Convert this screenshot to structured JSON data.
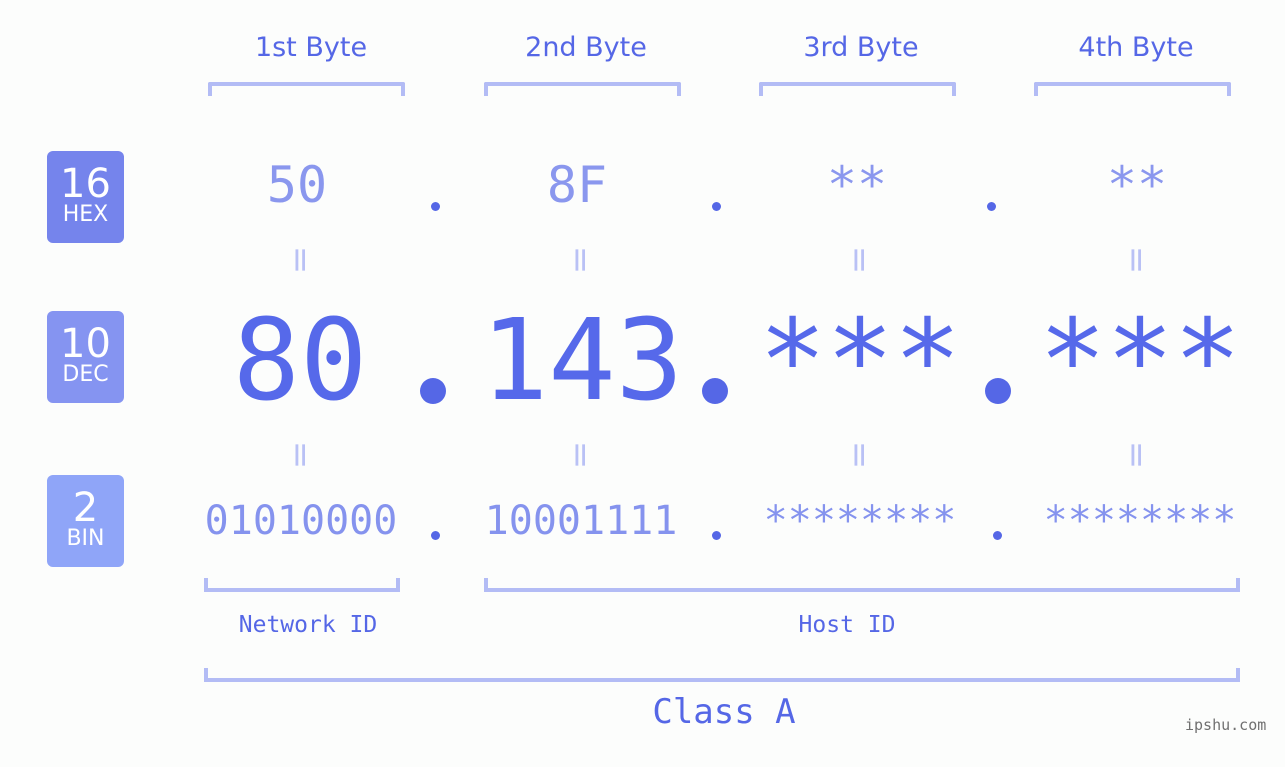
{
  "bytes": [
    {
      "label": "1st Byte",
      "hex": "50",
      "dec": "80",
      "bin": "01010000"
    },
    {
      "label": "2nd Byte",
      "hex": "8F",
      "dec": "143",
      "bin": "10001111"
    },
    {
      "label": "3rd Byte",
      "hex": "**",
      "dec": "***",
      "bin": "********"
    },
    {
      "label": "4th Byte",
      "hex": "**",
      "dec": "***",
      "bin": "********"
    }
  ],
  "badges": {
    "hex": {
      "num": "16",
      "label": "HEX",
      "color": "#7584ec"
    },
    "dec": {
      "num": "10",
      "label": "DEC",
      "color": "#8594f1"
    },
    "bin": {
      "num": "2",
      "label": "BIN",
      "color": "#8fa5f8"
    }
  },
  "equals_symbol": "=",
  "network_id_label": "Network ID",
  "host_id_label": "Host ID",
  "class_label": "Class A",
  "watermark": "ipshu.com",
  "colors": {
    "accent": "#5567e6",
    "bracket": "#b3bcf5",
    "background": "#fcfdfc"
  }
}
